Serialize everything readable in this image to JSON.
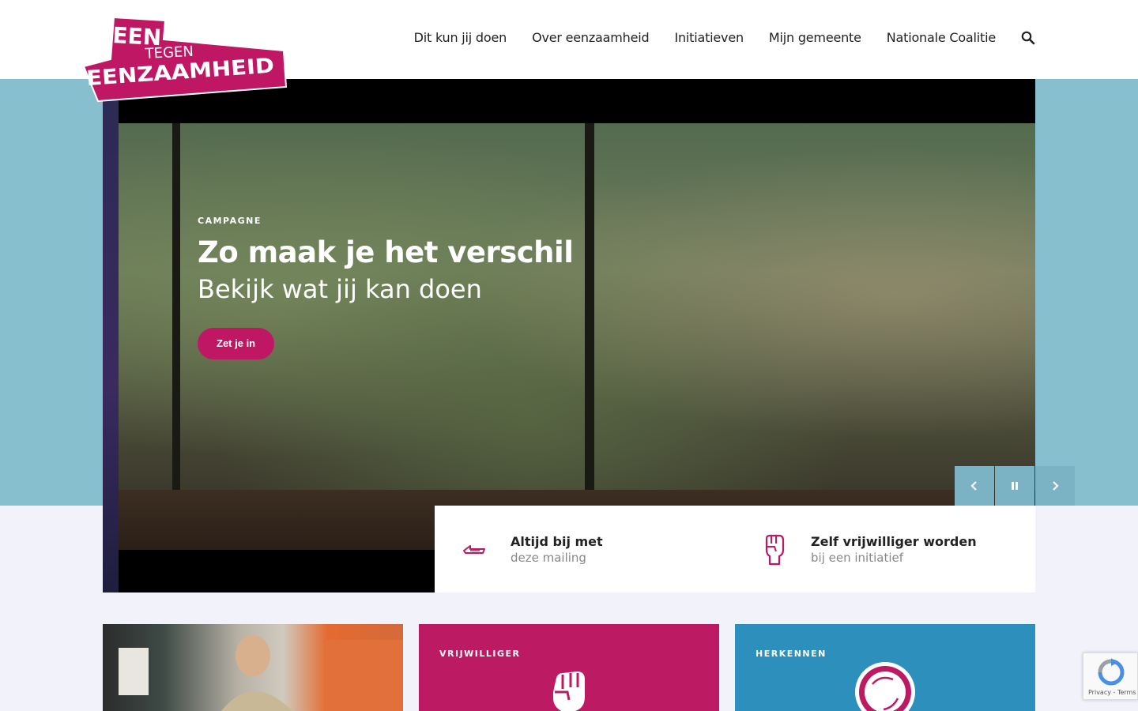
{
  "logo": {
    "line1": "EEN",
    "line2": "TEGEN",
    "line3": "EENZAAMHEID"
  },
  "nav": {
    "items": [
      "Dit kun jij doen",
      "Over eenzaamheid",
      "Initiatieven",
      "Mijn gemeente",
      "Nationale Coalitie"
    ],
    "search_icon": "search-icon"
  },
  "hero": {
    "eyebrow": "CAMPAGNE",
    "title": "Zo maak je het verschil",
    "subtitle": "Bekijk wat jij kan doen",
    "cta": "Zet je in"
  },
  "slider": {
    "prev_icon": "chevron-left-icon",
    "pause_icon": "pause-icon",
    "next_icon": "chevron-right-icon"
  },
  "info": [
    {
      "title": "Altijd bij met",
      "sub": "deze mailing",
      "icon": "paper-plane-icon"
    },
    {
      "title": "Zelf vrijwilliger worden",
      "sub": "bij een initiatief",
      "icon": "raised-fist-icon"
    }
  ],
  "cards": [
    {
      "label": ""
    },
    {
      "label": "VRIJWILLIGER",
      "icon": "raised-fist-icon"
    },
    {
      "label": "HERKENNEN",
      "icon": "circle-icon"
    }
  ],
  "recaptcha": {
    "links": "Privacy - Terms"
  },
  "colors": {
    "brand": "#c01765",
    "band": "#88bfcf",
    "blue": "#2d8fbb",
    "page_bg": "#f2f2fa"
  }
}
